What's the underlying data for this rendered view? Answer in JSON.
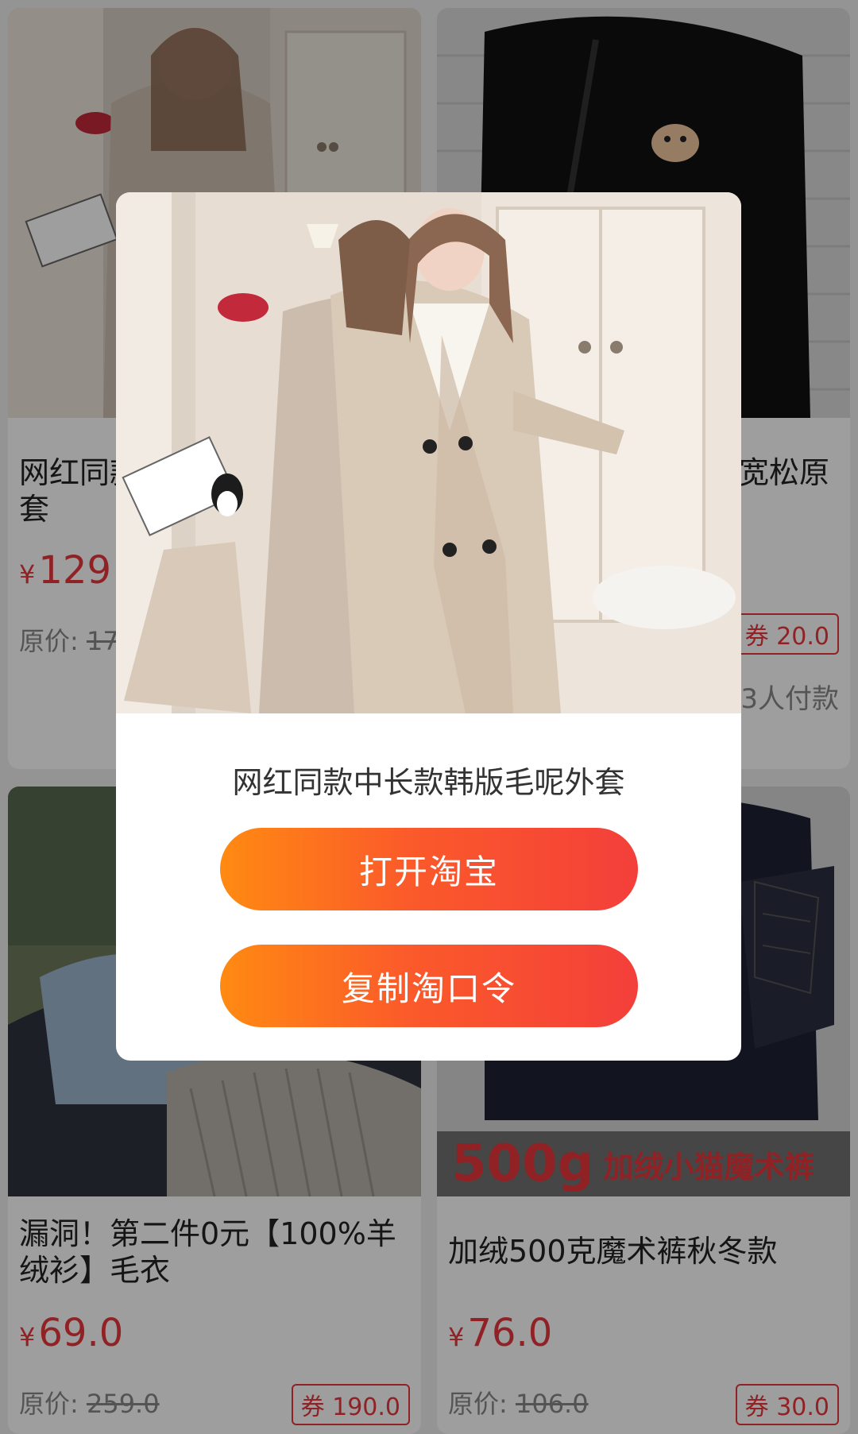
{
  "colors": {
    "accent": "#e8383d",
    "button_gradient_start": "#ff8a12",
    "button_gradient_end": "#f33f3a"
  },
  "products": [
    {
      "title": "网红同款中长款韩版毛呢外套",
      "price_symbol": "¥",
      "price": "129",
      "orig_label": "原价: ",
      "orig_value": "17"
    },
    {
      "title": "宽松原",
      "coupon": "券 20.0",
      "sales": "3人付款"
    },
    {
      "title": "漏洞！第二件0元【100%羊绒衫】毛衣",
      "price_symbol": "¥",
      "price": "69.0",
      "orig_label": "原价: ",
      "orig_value": "259.0",
      "coupon": "券 190.0"
    },
    {
      "title": "加绒500克魔术裤秋冬款",
      "price_symbol": "¥",
      "price": "76.0",
      "orig_label": "原价: ",
      "orig_value": "106.0",
      "coupon": "券 30.0",
      "image_text_big": "500g",
      "image_text_small": "加绒小猫魔术裤"
    }
  ],
  "modal": {
    "title": "网红同款中长款韩版毛呢外套",
    "open_button": "打开淘宝",
    "copy_button": "复制淘口令"
  }
}
